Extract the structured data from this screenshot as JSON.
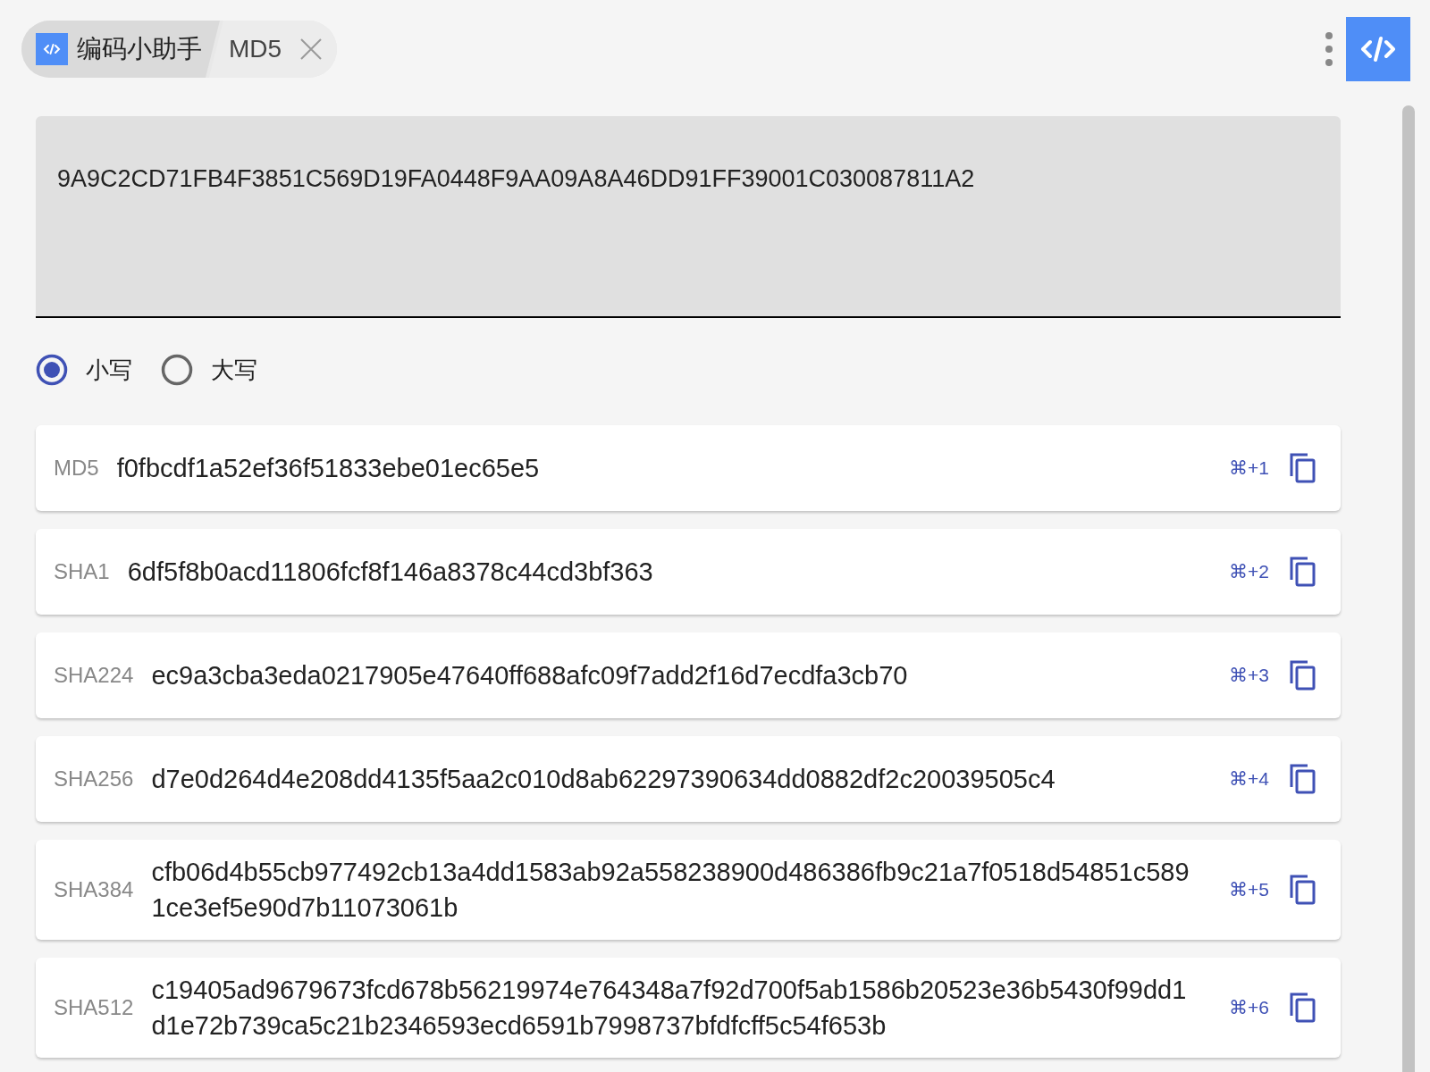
{
  "tabs": [
    {
      "kind": "app",
      "label": "编码小助手",
      "selected": false
    },
    {
      "kind": "tool",
      "label": "MD5",
      "selected": true
    }
  ],
  "input": {
    "value": "9A9C2CD71FB4F3851C569D19FA0448F9AA09A8A46DD91FF39001C030087811A2"
  },
  "case_options": [
    {
      "label": "小写",
      "selected": true
    },
    {
      "label": "大写",
      "selected": false
    }
  ],
  "results": [
    {
      "algorithm": "MD5",
      "hash": "f0fbcdf1a52ef36f51833ebe01ec65e5",
      "shortcut": "⌘+1"
    },
    {
      "algorithm": "SHA1",
      "hash": "6df5f8b0acd11806fcf8f146a8378c44cd3bf363",
      "shortcut": "⌘+2"
    },
    {
      "algorithm": "SHA224",
      "hash": "ec9a3cba3eda0217905e47640ff688afc09f7add2f16d7ecdfa3cb70",
      "shortcut": "⌘+3"
    },
    {
      "algorithm": "SHA256",
      "hash": "d7e0d264d4e208dd4135f5aa2c010d8ab62297390634dd0882df2c20039505c4",
      "shortcut": "⌘+4"
    },
    {
      "algorithm": "SHA384",
      "hash": "cfb06d4b55cb977492cb13a4dd1583ab92a558238900d486386fb9c21a7f0518d54851c5891ce3ef5e90d7b11073061b",
      "shortcut": "⌘+5"
    },
    {
      "algorithm": "SHA512",
      "hash": "c19405ad9679673fcd678b56219974e764348a7f92d700f5ab1586b20523e36b5430f99dd1d1e72b739ca5c21b2346593ecd6591b7998737bfdfcff5c54f653b",
      "shortcut": "⌘+6"
    }
  ]
}
